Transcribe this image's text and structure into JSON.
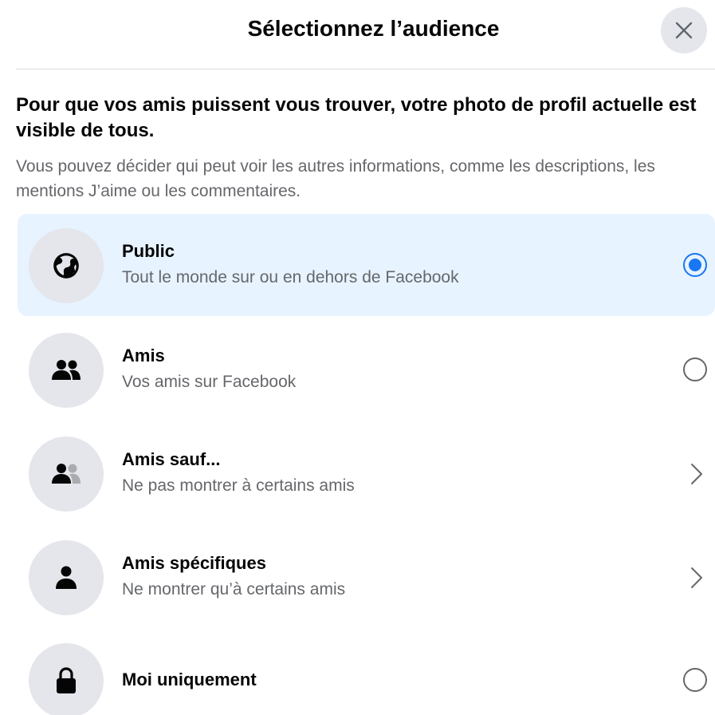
{
  "dialog": {
    "title": "Sélectionnez l’audience",
    "close_label": "Fermer"
  },
  "intro": {
    "title": "Pour que vos amis puissent vous trouver, votre photo de profil actuelle est visible de tous.",
    "text": "Vous pouvez décider qui peut voir les autres informations, comme les descriptions, les mentions J’aime ou les commentaires."
  },
  "options": [
    {
      "title": "Public",
      "subtitle": "Tout le monde sur ou en dehors de Facebook",
      "icon": "globe-icon",
      "control": "radio",
      "selected": true
    },
    {
      "title": "Amis",
      "subtitle": "Vos amis sur Facebook",
      "icon": "friends-icon",
      "control": "radio",
      "selected": false
    },
    {
      "title": "Amis sauf...",
      "subtitle": "Ne pas montrer à certains amis",
      "icon": "friends-except-icon",
      "control": "chevron",
      "selected": false
    },
    {
      "title": "Amis spécifiques",
      "subtitle": "Ne montrer qu’à certains amis",
      "icon": "person-icon",
      "control": "chevron",
      "selected": false
    },
    {
      "title": "Moi uniquement",
      "subtitle": "",
      "icon": "lock-icon",
      "control": "radio",
      "selected": false
    }
  ],
  "colors": {
    "accent": "#1877f2",
    "selected_bg": "#e7f3ff",
    "icon_bg": "#e4e6eb",
    "secondary_text": "#65676b"
  }
}
